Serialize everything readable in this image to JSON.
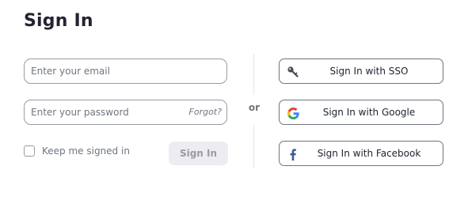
{
  "header": {
    "title": "Sign In"
  },
  "form": {
    "email_placeholder": "Enter your email",
    "email_value": "",
    "password_placeholder": "Enter your password",
    "password_value": "",
    "forgot_label": "Forgot?",
    "remember_label": "Keep me signed in",
    "remember_checked": false,
    "signin_label": "Sign In",
    "signin_enabled": false
  },
  "divider": {
    "or_label": "or"
  },
  "social": {
    "items": [
      {
        "label": "Sign In with SSO",
        "icon": "key-icon"
      },
      {
        "label": "Sign In with Google",
        "icon": "google-icon"
      },
      {
        "label": "Sign In with Facebook",
        "icon": "facebook-icon"
      }
    ]
  },
  "colors": {
    "text_primary": "#232333",
    "text_secondary": "#6e7680",
    "border": "#9a9aa4",
    "disabled_button_bg": "#ededf1",
    "facebook_blue": "#3b5998",
    "google_blue": "#4285F4",
    "google_red": "#EA4335",
    "google_yellow": "#FBBC05",
    "google_green": "#34A853"
  }
}
